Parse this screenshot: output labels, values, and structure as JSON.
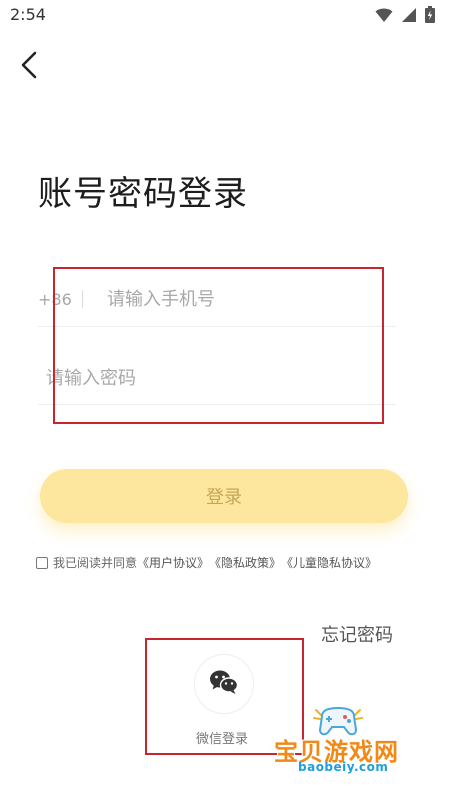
{
  "status_bar": {
    "time": "2:54"
  },
  "header": {
    "back_icon": "chevron-left-icon"
  },
  "page": {
    "title": "账号密码登录"
  },
  "phone": {
    "country_code": "+86",
    "placeholder": "请输入手机号",
    "value": ""
  },
  "password": {
    "placeholder": "请输入密码",
    "value": ""
  },
  "login_button": {
    "label": "登录"
  },
  "agreement": {
    "prefix": "我已阅读并同意",
    "user_agreement": "《用户协议》",
    "privacy_policy": "《隐私政策》",
    "child_privacy": "《儿童隐私协议》",
    "checked": false
  },
  "forgot_password": {
    "label": "忘记密码"
  },
  "wechat_login": {
    "icon": "wechat-icon",
    "label": "微信登录"
  },
  "watermark": {
    "title": "宝贝游戏网",
    "domain": "baobeiy.com"
  },
  "colors": {
    "login_button_bg": "#fde69d",
    "login_button_text": "#c2a756",
    "highlight_border": "#c8262e",
    "placeholder": "#a8a8a8"
  }
}
